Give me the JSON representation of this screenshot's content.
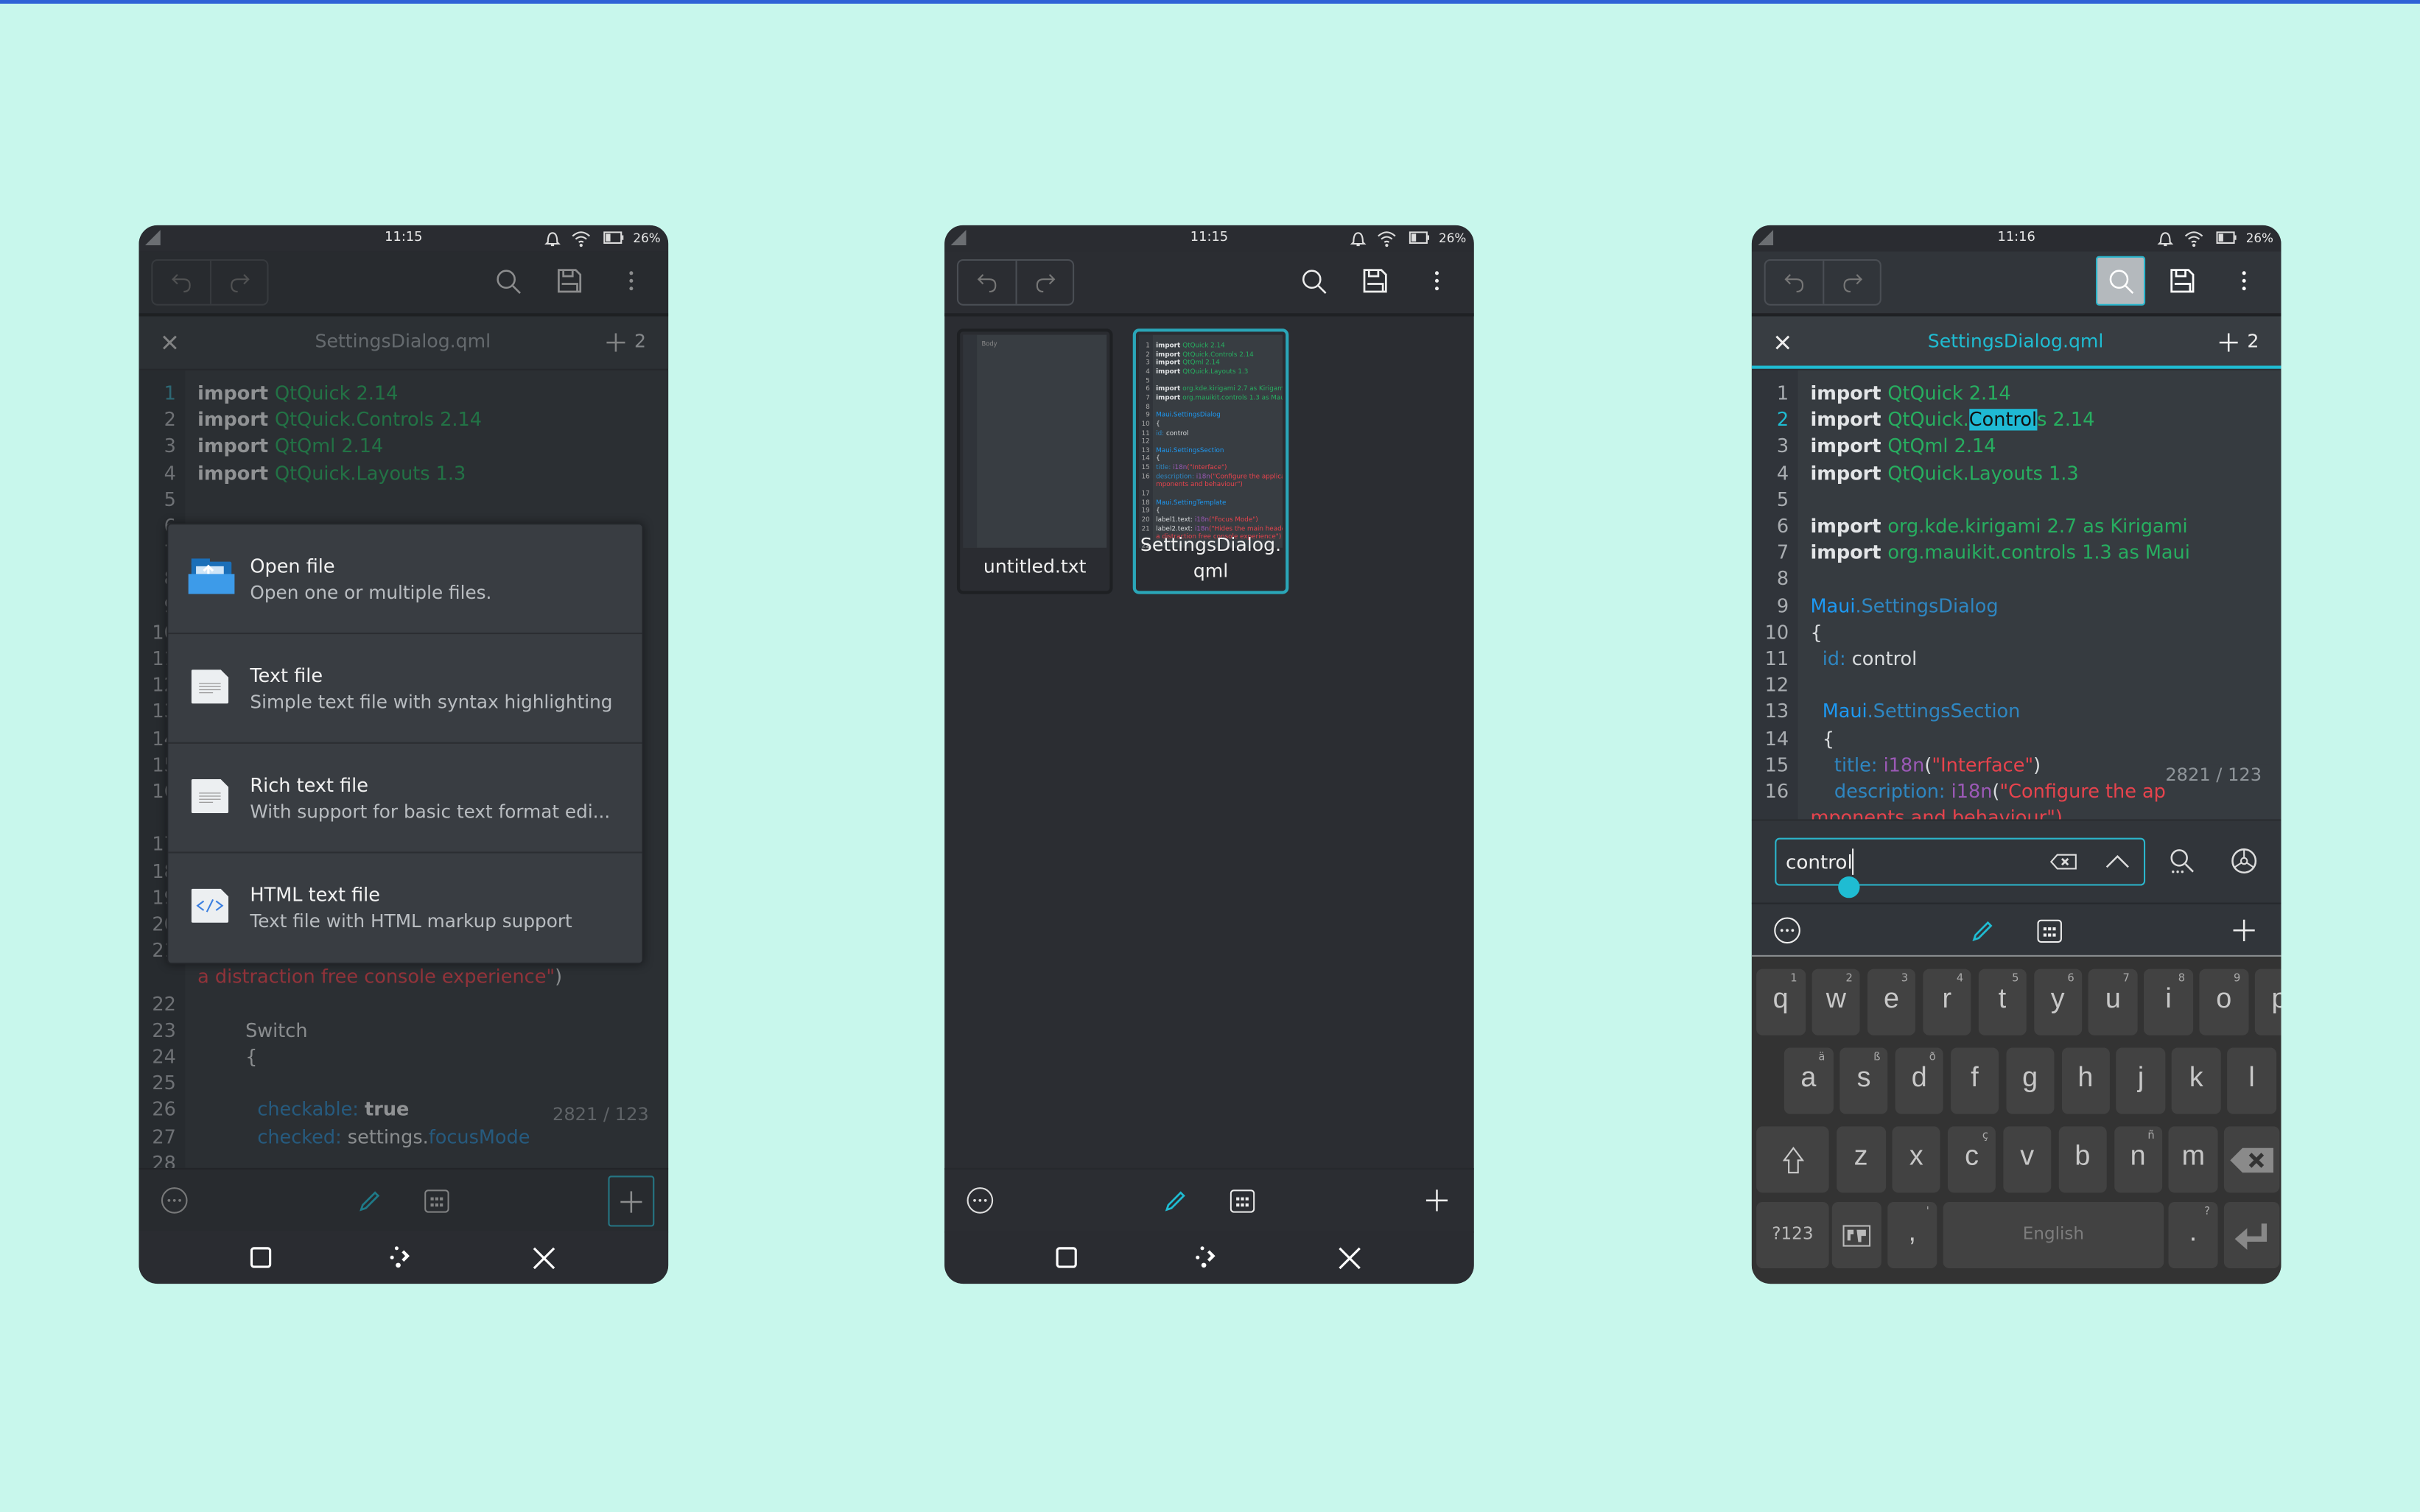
{
  "colors": {
    "background": "#c8f7ec",
    "accent": "#1fbcd2",
    "panel": "#2b2d32",
    "keyword": "#e3e5e7",
    "module": "#27ae60",
    "type": "#1d99f3",
    "string": "#e7434d",
    "function": "#9b59b6"
  },
  "status": {
    "battery": "26%"
  },
  "phone1": {
    "time": "11:15",
    "tab_title": "SettingsDialog.qml",
    "tab_count": "2",
    "counter": "2821 / 123",
    "rows": [
      {
        "n": "1",
        "t": [
          [
            "import ",
            "kw"
          ],
          [
            "QtQuick 2.14",
            "mod"
          ]
        ]
      },
      {
        "n": "2",
        "t": [
          [
            "import ",
            "kw"
          ],
          [
            "QtQuick.Controls 2.14",
            "mod"
          ]
        ]
      },
      {
        "n": "3",
        "t": [
          [
            "import ",
            "kw"
          ],
          [
            "QtQml 2.14",
            "mod"
          ]
        ]
      },
      {
        "n": "4",
        "t": [
          [
            "import ",
            "kw"
          ],
          [
            "QtQuick.Layouts 1.3",
            "mod"
          ]
        ]
      },
      {
        "n": "5",
        "t": []
      },
      {
        "n": "6",
        "t": []
      },
      {
        "n": "7",
        "t": []
      },
      {
        "n": "8",
        "t": []
      },
      {
        "n": "9",
        "t": []
      },
      {
        "n": "10",
        "t": []
      },
      {
        "n": "11",
        "t": []
      },
      {
        "n": "12",
        "t": []
      },
      {
        "n": "13",
        "t": []
      },
      {
        "n": "14",
        "t": []
      },
      {
        "n": "15",
        "t": []
      },
      {
        "n": "16",
        "t": []
      },
      {
        "n": "",
        "t": []
      },
      {
        "n": "17",
        "t": []
      },
      {
        "n": "18",
        "t": []
      },
      {
        "n": "19",
        "t": []
      },
      {
        "n": "20",
        "t": []
      },
      {
        "n": "21",
        "t": []
      },
      {
        "n": "",
        "t": [
          [
            "a distraction free console experience\"",
            "str"
          ],
          [
            ")",
            "pl"
          ]
        ]
      },
      {
        "n": "22",
        "t": []
      },
      {
        "n": "23",
        "t": [
          [
            "        Switch",
            "pl"
          ]
        ]
      },
      {
        "n": "24",
        "t": [
          [
            "        {",
            "pl"
          ]
        ]
      },
      {
        "n": "25",
        "t": []
      },
      {
        "n": "26",
        "t": [
          [
            "          checkable: ",
            "prop"
          ],
          [
            "true",
            "kw"
          ]
        ]
      },
      {
        "n": "27",
        "t": [
          [
            "          checked: ",
            "prop"
          ],
          [
            "settings.",
            "pl"
          ],
          [
            "focusMode",
            "prop"
          ]
        ]
      },
      {
        "n": "28",
        "t": []
      }
    ],
    "menu": [
      {
        "title": "Open file",
        "subtitle": "Open one or multiple files.",
        "icon": "folder-open-icon"
      },
      {
        "title": "Text file",
        "subtitle": "Simple text file with syntax highlighting",
        "icon": "text-file-icon"
      },
      {
        "title": "Rich text file",
        "subtitle": "With support for basic text format edi...",
        "icon": "rich-text-file-icon"
      },
      {
        "title": "HTML text file",
        "subtitle": "Text file with HTML markup support",
        "icon": "html-file-icon"
      }
    ]
  },
  "phone2": {
    "time": "11:15",
    "tiles": [
      {
        "label": "untitled.txt",
        "preview_placeholder": "Body"
      },
      {
        "label": "SettingsDialog.\nqml"
      }
    ],
    "preview_rows": [
      {
        "n": "1",
        "t": [
          [
            "import ",
            "kw"
          ],
          [
            "QtQuick 2.14",
            "mod"
          ]
        ]
      },
      {
        "n": "2",
        "t": [
          [
            "import ",
            "kw"
          ],
          [
            "QtQuick.Controls 2.14",
            "mod"
          ]
        ]
      },
      {
        "n": "3",
        "t": [
          [
            "import ",
            "kw"
          ],
          [
            "QtQml 2.14",
            "mod"
          ]
        ]
      },
      {
        "n": "4",
        "t": [
          [
            "import ",
            "kw"
          ],
          [
            "QtQuick.Layouts 1.3",
            "mod"
          ]
        ]
      },
      {
        "n": "5",
        "t": []
      },
      {
        "n": "6",
        "t": [
          [
            "import ",
            "kw"
          ],
          [
            "org.kde.kirigami 2.7 as Kirigami",
            "mod"
          ]
        ]
      },
      {
        "n": "7",
        "t": [
          [
            "import ",
            "kw"
          ],
          [
            "org.mauikit.controls 1.3 as Maui",
            "mod"
          ]
        ]
      },
      {
        "n": "8",
        "t": []
      },
      {
        "n": "9",
        "t": [
          [
            "Maui.SettingsDialog",
            "type"
          ]
        ]
      },
      {
        "n": "10",
        "t": [
          [
            "{",
            "pl"
          ]
        ]
      },
      {
        "n": "11",
        "t": [
          [
            "  id: ",
            "prop"
          ],
          [
            "control",
            "pl"
          ]
        ]
      },
      {
        "n": "12",
        "t": []
      },
      {
        "n": "13",
        "t": [
          [
            "  Maui.SettingsSection",
            "type"
          ]
        ]
      },
      {
        "n": "14",
        "t": [
          [
            "  {",
            "pl"
          ]
        ]
      },
      {
        "n": "15",
        "t": [
          [
            "    title: ",
            "prop"
          ],
          [
            "i18n",
            "fn"
          ],
          [
            "(\"Interface\")",
            "str"
          ]
        ]
      },
      {
        "n": "16",
        "t": [
          [
            "    description: ",
            "prop"
          ],
          [
            "i18n",
            "fn"
          ],
          [
            "(\"Configure the application co",
            "str"
          ]
        ]
      },
      {
        "n": "",
        "t": [
          [
            "mponents and behaviour\")",
            "str"
          ]
        ]
      },
      {
        "n": "17",
        "t": []
      },
      {
        "n": "18",
        "t": [
          [
            "    Maui.SettingTemplate",
            "type"
          ]
        ]
      },
      {
        "n": "19",
        "t": [
          [
            "    {",
            "pl"
          ]
        ]
      },
      {
        "n": "20",
        "t": [
          [
            "      label1.text: ",
            "pl"
          ],
          [
            "i18n",
            "fn"
          ],
          [
            "(\"Focus Mode\")",
            "str"
          ]
        ]
      },
      {
        "n": "21",
        "t": [
          [
            "      label2.text: ",
            "pl"
          ],
          [
            "i18n",
            "fn"
          ],
          [
            "(\"Hides the main header for",
            "str"
          ]
        ]
      },
      {
        "n": "",
        "t": [
          [
            "a distraction free console experience\")",
            "str"
          ]
        ]
      },
      {
        "n": "22",
        "t": []
      }
    ]
  },
  "phone3": {
    "time": "11:16",
    "tab_title": "SettingsDialog.qml",
    "tab_count": "2",
    "counter": "2821 / 123",
    "find_value": "control",
    "rows": [
      {
        "n": "1",
        "t": [
          [
            "import ",
            "kw"
          ],
          [
            "QtQuick 2.14",
            "mod"
          ]
        ]
      },
      {
        "n": "2",
        "active": true,
        "t": [
          [
            "import ",
            "kw"
          ],
          [
            "QtQuick.",
            "mod"
          ],
          [
            "Control",
            "hl"
          ],
          [
            "s 2.14",
            "mod"
          ]
        ]
      },
      {
        "n": "3",
        "t": [
          [
            "import ",
            "kw"
          ],
          [
            "QtQml 2.14",
            "mod"
          ]
        ]
      },
      {
        "n": "4",
        "t": [
          [
            "import ",
            "kw"
          ],
          [
            "QtQuick.Layouts 1.3",
            "mod"
          ]
        ]
      },
      {
        "n": "5",
        "t": []
      },
      {
        "n": "6",
        "t": [
          [
            "import ",
            "kw"
          ],
          [
            "org.kde.kirigami 2.7 as Kirigami",
            "mod"
          ]
        ]
      },
      {
        "n": "7",
        "t": [
          [
            "import ",
            "kw"
          ],
          [
            "org.mauikit.controls 1.3 as Maui",
            "mod"
          ]
        ]
      },
      {
        "n": "8",
        "t": []
      },
      {
        "n": "9",
        "t": [
          [
            "Maui",
            "type"
          ],
          [
            ".SettingsDialog",
            "prop"
          ]
        ]
      },
      {
        "n": "10",
        "t": [
          [
            "{",
            "pl"
          ]
        ]
      },
      {
        "n": "11",
        "t": [
          [
            "  id: ",
            "prop"
          ],
          [
            "control",
            "pl"
          ]
        ]
      },
      {
        "n": "12",
        "t": []
      },
      {
        "n": "13",
        "t": [
          [
            "  Maui",
            "type"
          ],
          [
            ".SettingsSection",
            "prop"
          ]
        ]
      },
      {
        "n": "14",
        "t": [
          [
            "  {",
            "pl"
          ]
        ]
      },
      {
        "n": "15",
        "t": [
          [
            "    title: ",
            "prop"
          ],
          [
            "i18n",
            "fn"
          ],
          [
            "(",
            "pl"
          ],
          [
            "\"Interface\"",
            "str"
          ],
          [
            ")",
            "pl"
          ]
        ]
      },
      {
        "n": "16",
        "t": [
          [
            "    description: ",
            "prop"
          ],
          [
            "i18n",
            "fn"
          ],
          [
            "(",
            "pl"
          ],
          [
            "\"Configure the ap",
            "str"
          ]
        ]
      },
      {
        "n": "",
        "t": [
          [
            "mponents and behaviour\")",
            "str"
          ]
        ]
      }
    ],
    "keyboard": {
      "rows": [
        [
          {
            "k": "q",
            "h": "1"
          },
          {
            "k": "w",
            "h": "2"
          },
          {
            "k": "e",
            "h": "3"
          },
          {
            "k": "r",
            "h": "4"
          },
          {
            "k": "t",
            "h": "5"
          },
          {
            "k": "y",
            "h": "6"
          },
          {
            "k": "u",
            "h": "7"
          },
          {
            "k": "i",
            "h": "8"
          },
          {
            "k": "o",
            "h": "9"
          },
          {
            "k": "p",
            "h": "0"
          }
        ],
        [
          {
            "k": "a",
            "h": "ä"
          },
          {
            "k": "s",
            "h": "ß"
          },
          {
            "k": "d",
            "h": "ð"
          },
          {
            "k": "f",
            "h": ""
          },
          {
            "k": "g",
            "h": ""
          },
          {
            "k": "h",
            "h": ""
          },
          {
            "k": "j",
            "h": ""
          },
          {
            "k": "k",
            "h": ""
          },
          {
            "k": "l",
            "h": ""
          }
        ],
        [
          {
            "k": "z",
            "h": ""
          },
          {
            "k": "x",
            "h": ""
          },
          {
            "k": "c",
            "h": "ç"
          },
          {
            "k": "v",
            "h": ""
          },
          {
            "k": "b",
            "h": ""
          },
          {
            "k": "n",
            "h": "ñ"
          },
          {
            "k": "m",
            "h": ""
          }
        ]
      ],
      "symbols_label": "?123",
      "comma": ",",
      "comma_hint": "'",
      "space_label": "English",
      "period": ".",
      "period_hint": "?"
    }
  }
}
